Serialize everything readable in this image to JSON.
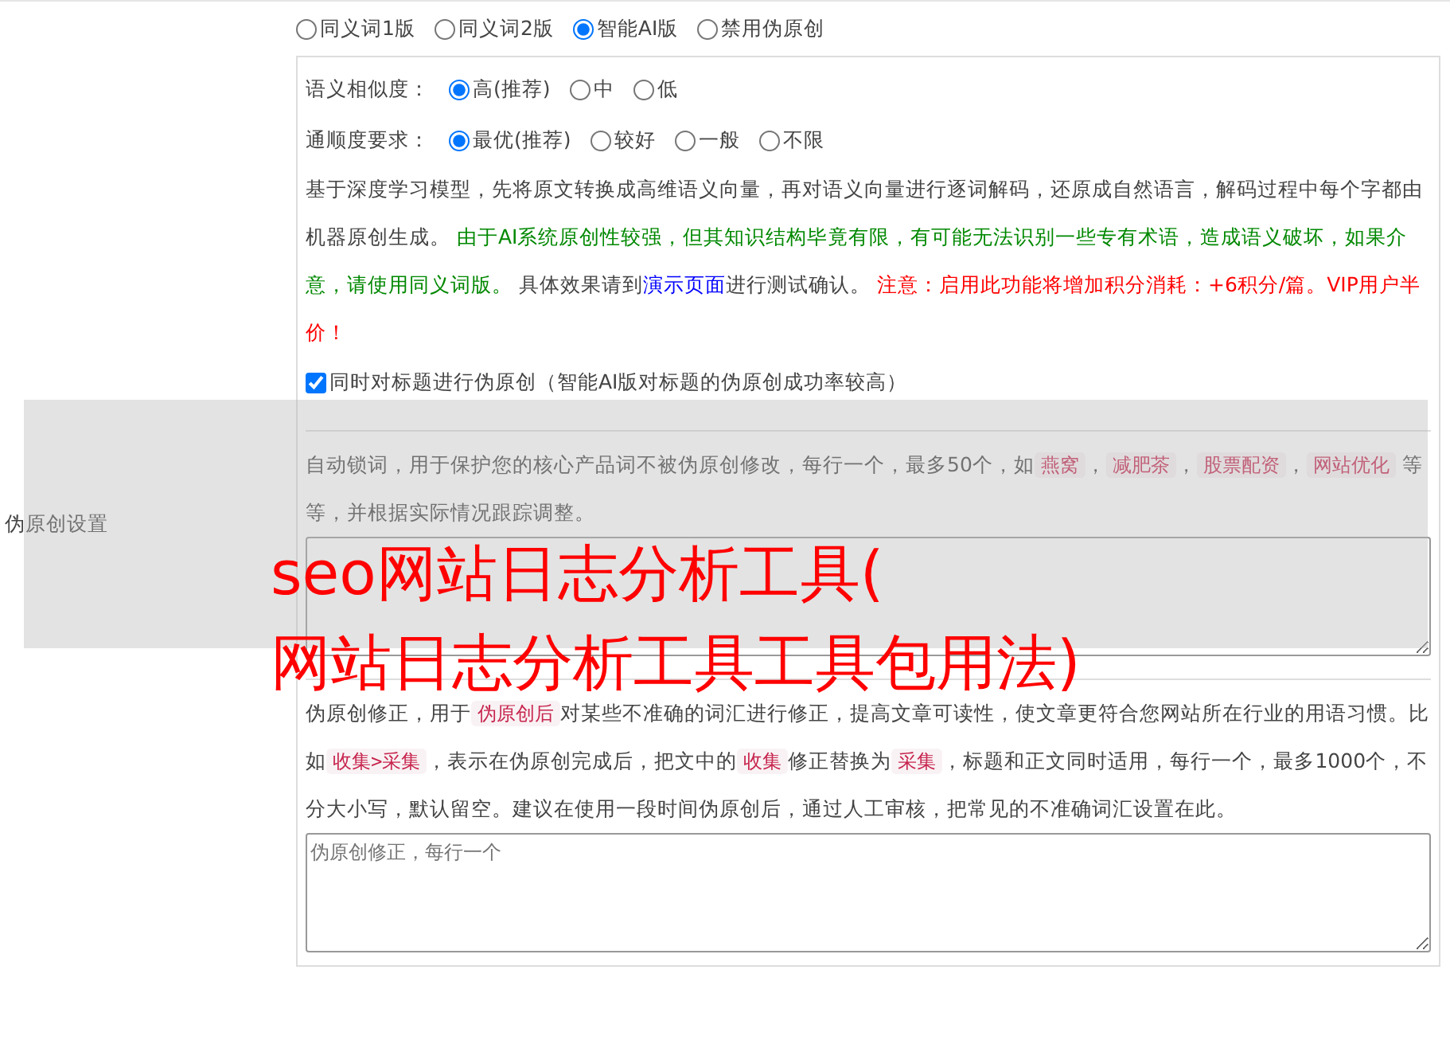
{
  "section_label": "伪原创设置",
  "modes": [
    {
      "label": "同义词1版",
      "selected": false
    },
    {
      "label": "同义词2版",
      "selected": false
    },
    {
      "label": "智能AI版",
      "selected": true
    },
    {
      "label": "禁用伪原创",
      "selected": false
    }
  ],
  "similarity": {
    "label": "语义相似度：",
    "options": [
      {
        "label": "高(推荐)",
        "selected": true
      },
      {
        "label": "中",
        "selected": false
      },
      {
        "label": "低",
        "selected": false
      }
    ]
  },
  "fluency": {
    "label": "通顺度要求：",
    "options": [
      {
        "label": "最优(推荐)",
        "selected": true
      },
      {
        "label": "较好",
        "selected": false
      },
      {
        "label": "一般",
        "selected": false
      },
      {
        "label": "不限",
        "selected": false
      }
    ]
  },
  "ai_note": [
    {
      "kind": "text",
      "text": "基于深度学习模型，先将原文转换成高维语义向量，再对语义向量进行逐词解码，还原成自然语言，解码过程中每个字都由机器原创生成。 "
    },
    {
      "kind": "green",
      "text": "由于AI系统原创性较强，但其知识结构毕竟有限，有可能无法识别一些专有术语，造成语义破坏，如果介意，请使用同义词版。"
    },
    {
      "kind": "text",
      "text": " 具体效果请到"
    },
    {
      "kind": "link",
      "text": "演示页面"
    },
    {
      "kind": "text",
      "text": "进行测试确认。 "
    },
    {
      "kind": "red",
      "text": "注意：启用此功能将增加积分消耗：+6积分/篇。VIP用户半价！"
    }
  ],
  "title_checkbox": {
    "label": "同时对标题进行伪原创（智能AI版对标题的伪原创成功率较高）",
    "checked": true
  },
  "lock_words": {
    "description": [
      {
        "kind": "text",
        "text": "自动锁词，用于保护您的核心产品词不被伪原创修改，每行一个，最多50个，如"
      },
      {
        "kind": "code",
        "text": "燕窝"
      },
      {
        "kind": "text",
        "text": "，"
      },
      {
        "kind": "code",
        "text": "减肥茶"
      },
      {
        "kind": "text",
        "text": "，"
      },
      {
        "kind": "code",
        "text": "股票配资"
      },
      {
        "kind": "text",
        "text": "，"
      },
      {
        "kind": "code",
        "text": "网站优化"
      },
      {
        "kind": "text",
        "text": " 等等，并根据实际情况跟踪调整。"
      }
    ]
  },
  "correction": {
    "description": [
      {
        "kind": "text",
        "text": "伪原创修正，用于"
      },
      {
        "kind": "code",
        "text": "伪原创后"
      },
      {
        "kind": "text",
        "text": "对某些不准确的词汇进行修正，提高文章可读性，使文章更符合您网站所在行业的用语习惯。比如"
      },
      {
        "kind": "code",
        "text": "收集>采集"
      },
      {
        "kind": "text",
        "text": "，表示在伪原创完成后，把文中的"
      },
      {
        "kind": "code",
        "text": "收集"
      },
      {
        "kind": "text",
        "text": "修正替换为"
      },
      {
        "kind": "code",
        "text": "采集"
      },
      {
        "kind": "text",
        "text": "，标题和正文同时适用，每行一个，最多1000个，不分大小写，默认留空。建议在使用一段时间伪原创后，通过人工审核，把常见的不准确词汇设置在此。"
      }
    ],
    "placeholder": "伪原创修正，每行一个"
  },
  "overlay": {
    "lines": [
      "seo网站日志分析工具(",
      "网站日志分析工具工具包用法)"
    ]
  }
}
